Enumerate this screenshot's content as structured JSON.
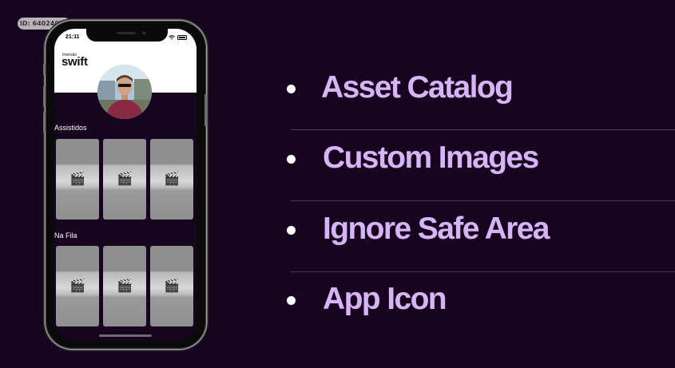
{
  "badge": {
    "id_text": "ID: 64024025"
  },
  "phone": {
    "status_time": "21:11",
    "logo_small": "Imersão",
    "logo_big": "swift",
    "sections": [
      {
        "title": "Assistidos",
        "posters": [
          "clapper-icon",
          "clapper-icon",
          "clapper-icon"
        ]
      },
      {
        "title": "Na Fila",
        "posters": [
          "clapper-icon",
          "clapper-icon",
          "clapper-icon"
        ]
      }
    ]
  },
  "bullets": [
    {
      "text": "Asset Catalog"
    },
    {
      "text": "Custom Images"
    },
    {
      "text": "Ignore Safe Area"
    },
    {
      "text": "App Icon"
    }
  ],
  "colors": {
    "background": "#17041f",
    "accent_text": "#d7b4f6",
    "bullet_dot": "#ffffff"
  }
}
